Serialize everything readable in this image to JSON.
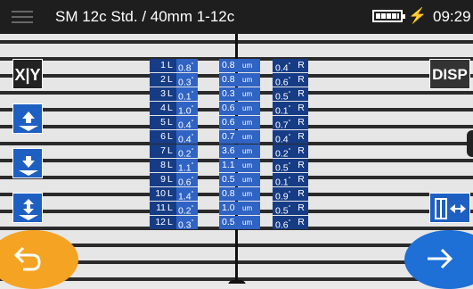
{
  "header": {
    "title": "SM 12c Std. / 40mm 1-12c",
    "time": "09:29",
    "battery_icon": "battery-full-icon",
    "charging_icon": "lightning-bolt-icon"
  },
  "buttons": {
    "xy": "X|Y",
    "disp": "DISP"
  },
  "table": {
    "side_label": "L",
    "angle_unit": "°",
    "gap_unit": "um",
    "loss_suffix": "R",
    "rows": [
      {
        "num": "1",
        "angle": "0.8",
        "gap": "0.8",
        "loss": "0.4"
      },
      {
        "num": "2",
        "angle": "0.3",
        "gap": "0.8",
        "loss": "0.6"
      },
      {
        "num": "3",
        "angle": "0.1",
        "gap": "0.3",
        "loss": "0.5"
      },
      {
        "num": "4",
        "angle": "1.0",
        "gap": "0.6",
        "loss": "0.1"
      },
      {
        "num": "5",
        "angle": "0.4",
        "gap": "0.6",
        "loss": "0.7"
      },
      {
        "num": "6",
        "angle": "0.4",
        "gap": "0.7",
        "loss": "0.4"
      },
      {
        "num": "7",
        "angle": "0.2",
        "gap": "3.6",
        "loss": "0.2"
      },
      {
        "num": "8",
        "angle": "1.1",
        "gap": "1.1",
        "loss": "0.5"
      },
      {
        "num": "9",
        "angle": "0.6",
        "gap": "0.5",
        "loss": "0.1"
      },
      {
        "num": "10",
        "angle": "1.4",
        "gap": "0.8",
        "loss": "0.9"
      },
      {
        "num": "11",
        "angle": "0.2",
        "gap": "1.0",
        "loss": "0.5"
      },
      {
        "num": "12",
        "angle": "0.3",
        "gap": "0.5",
        "loss": "0.6"
      }
    ]
  },
  "colors": {
    "accent_blue": "#1e5fc2",
    "back_orange": "#f5a323",
    "next_blue": "#1e6fd6"
  }
}
